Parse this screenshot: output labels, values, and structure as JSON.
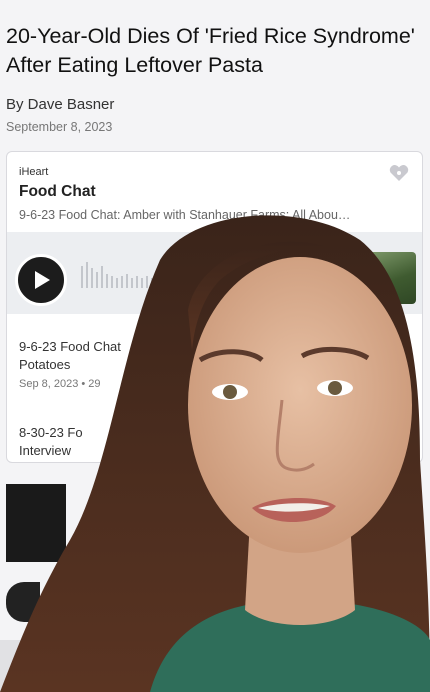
{
  "article": {
    "headline": "20-Year-Old Dies Of 'Fried Rice Syndrome' After Eating Leftover Pasta",
    "byline": "By Dave Basner",
    "date": "September 8, 2023"
  },
  "player": {
    "brand": "iHeart",
    "brand_icon": "iheart-logo-icon",
    "show_title": "Food Chat",
    "episode_subtitle": "9-6-23 Food Chat: Amber with Stanhauer Farms: All Abou…",
    "play_icon": "play-icon",
    "episodes": [
      {
        "title": "9-6-23 Food Chat",
        "title_line2": "Potatoes",
        "meta": "Sep 8, 2023 • 29"
      },
      {
        "title": "8-30-23 Fo",
        "title_line2": "Interview",
        "meta": ""
      }
    ]
  },
  "colors": {
    "page_bg": "#f4f4f6",
    "card_bg": "#ffffff",
    "play_bar_bg": "#eceef1",
    "play_button": "#1c1c1c",
    "sweater": "#2f6e5a"
  }
}
